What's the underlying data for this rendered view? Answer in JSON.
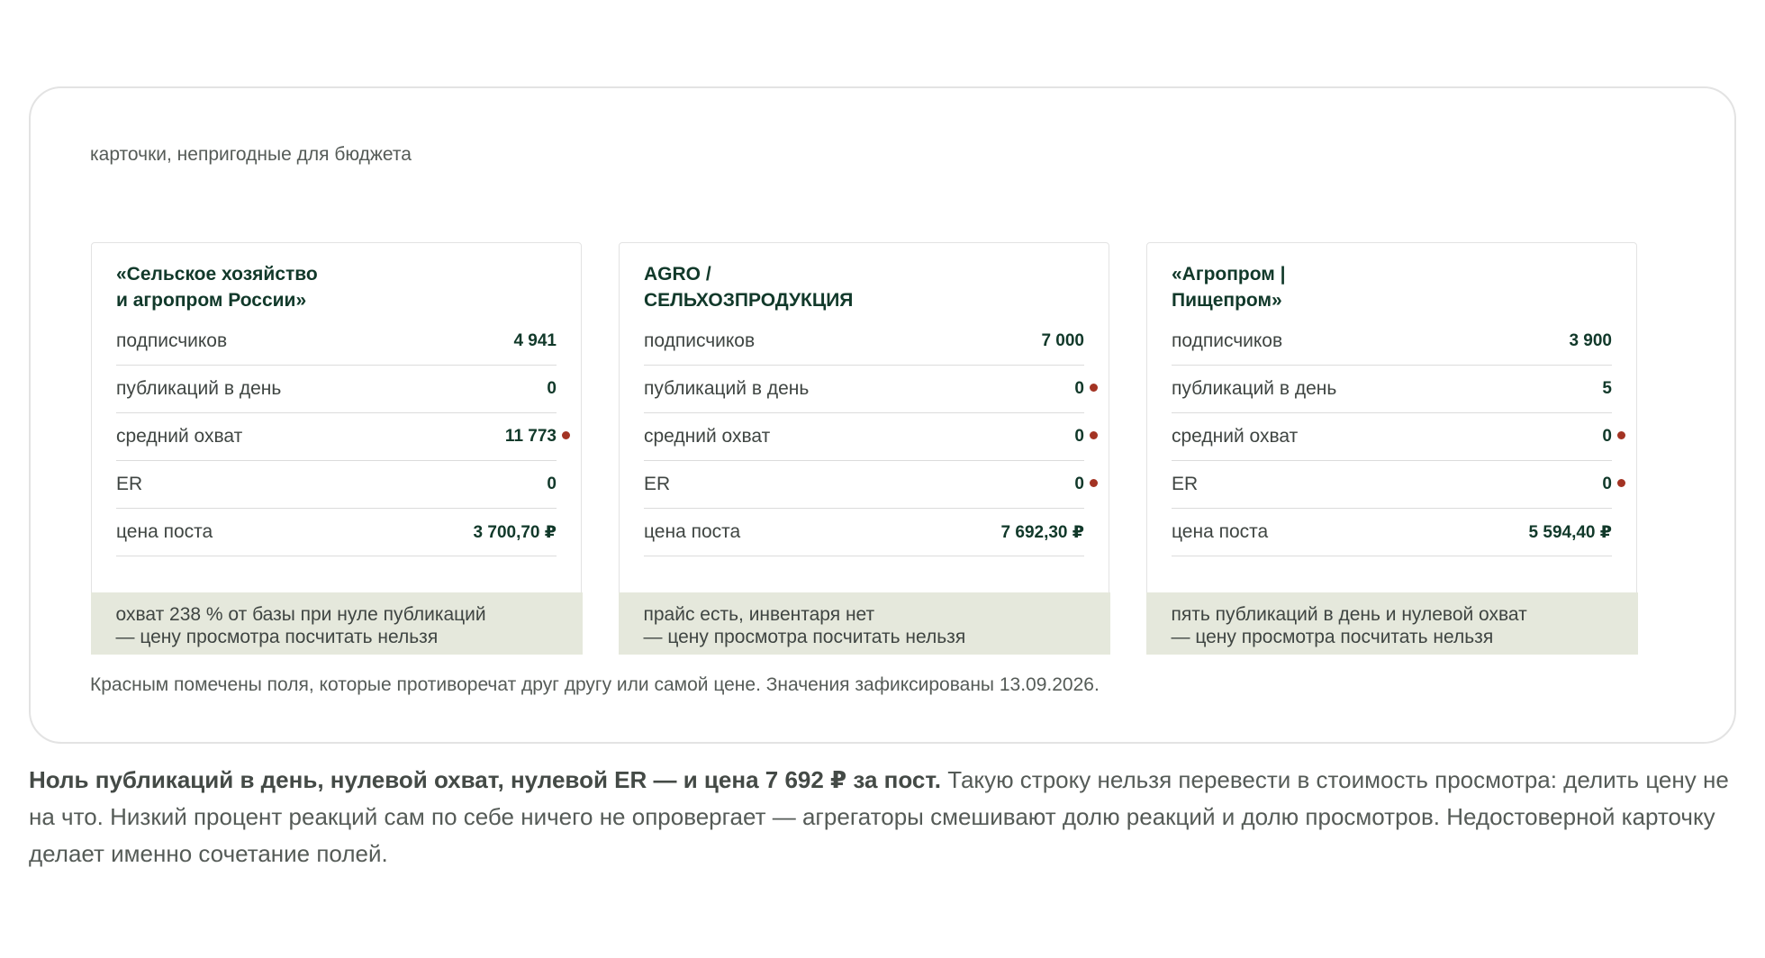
{
  "section_label": "карточки, непригодные для бюджета",
  "cards": [
    {
      "title_line1": "«Сельское хозяйство",
      "title_line2": "и агропром России»",
      "metrics": [
        {
          "label": "подписчиков",
          "value": "4 941",
          "flagged": false
        },
        {
          "label": "публикаций в день",
          "value": "0",
          "flagged": false
        },
        {
          "label": "средний охват",
          "value": "11 773",
          "flagged": true
        },
        {
          "label": "ER",
          "value": "0",
          "flagged": false
        },
        {
          "label": "цена поста",
          "value": "3 700,70 ₽",
          "flagged": false
        }
      ],
      "verdict_line1": "охват 238 % от базы при нуле публикаций",
      "verdict_line2": "— цену просмотра посчитать нельзя"
    },
    {
      "title_line1": "AGRO /",
      "title_line2": "СЕЛЬХОЗПРОДУКЦИЯ",
      "metrics": [
        {
          "label": "подписчиков",
          "value": "7 000",
          "flagged": false
        },
        {
          "label": "публикаций в день",
          "value": "0",
          "flagged": true
        },
        {
          "label": "средний охват",
          "value": "0",
          "flagged": true
        },
        {
          "label": "ER",
          "value": "0",
          "flagged": true
        },
        {
          "label": "цена поста",
          "value": "7 692,30 ₽",
          "flagged": false
        }
      ],
      "verdict_line1": "прайс есть, инвентаря нет",
      "verdict_line2": "— цену просмотра посчитать нельзя"
    },
    {
      "title_line1": "«Агропром |",
      "title_line2": "Пищепром»",
      "metrics": [
        {
          "label": "подписчиков",
          "value": "3 900",
          "flagged": false
        },
        {
          "label": "публикаций в день",
          "value": "5",
          "flagged": false
        },
        {
          "label": "средний охват",
          "value": "0",
          "flagged": true
        },
        {
          "label": "ER",
          "value": "0",
          "flagged": true
        },
        {
          "label": "цена поста",
          "value": "5 594,40 ₽",
          "flagged": false
        }
      ],
      "verdict_line1": "пять публикаций в день и нулевой охват",
      "verdict_line2": "— цену просмотра посчитать нельзя"
    }
  ],
  "flag_color": "#a33323",
  "footnote": "Красным помечены поля, которые противоречат друг другу или самой цене. Значения зафиксированы 13.09.2026.",
  "body": {
    "lead_bold": "Ноль публикаций в день, нулевой охват, нулевой ER — и цена 7 692 ₽ за пост.",
    "rest": " Такую строку нельзя перевести в стоимость просмотра: делить цену не на что. Низкий процент реакций сам по себе ничего не опровергает — агрегаторы смешивают долю реакций и долю просмотров. Недостоверной карточку делает именно сочетание полей."
  }
}
